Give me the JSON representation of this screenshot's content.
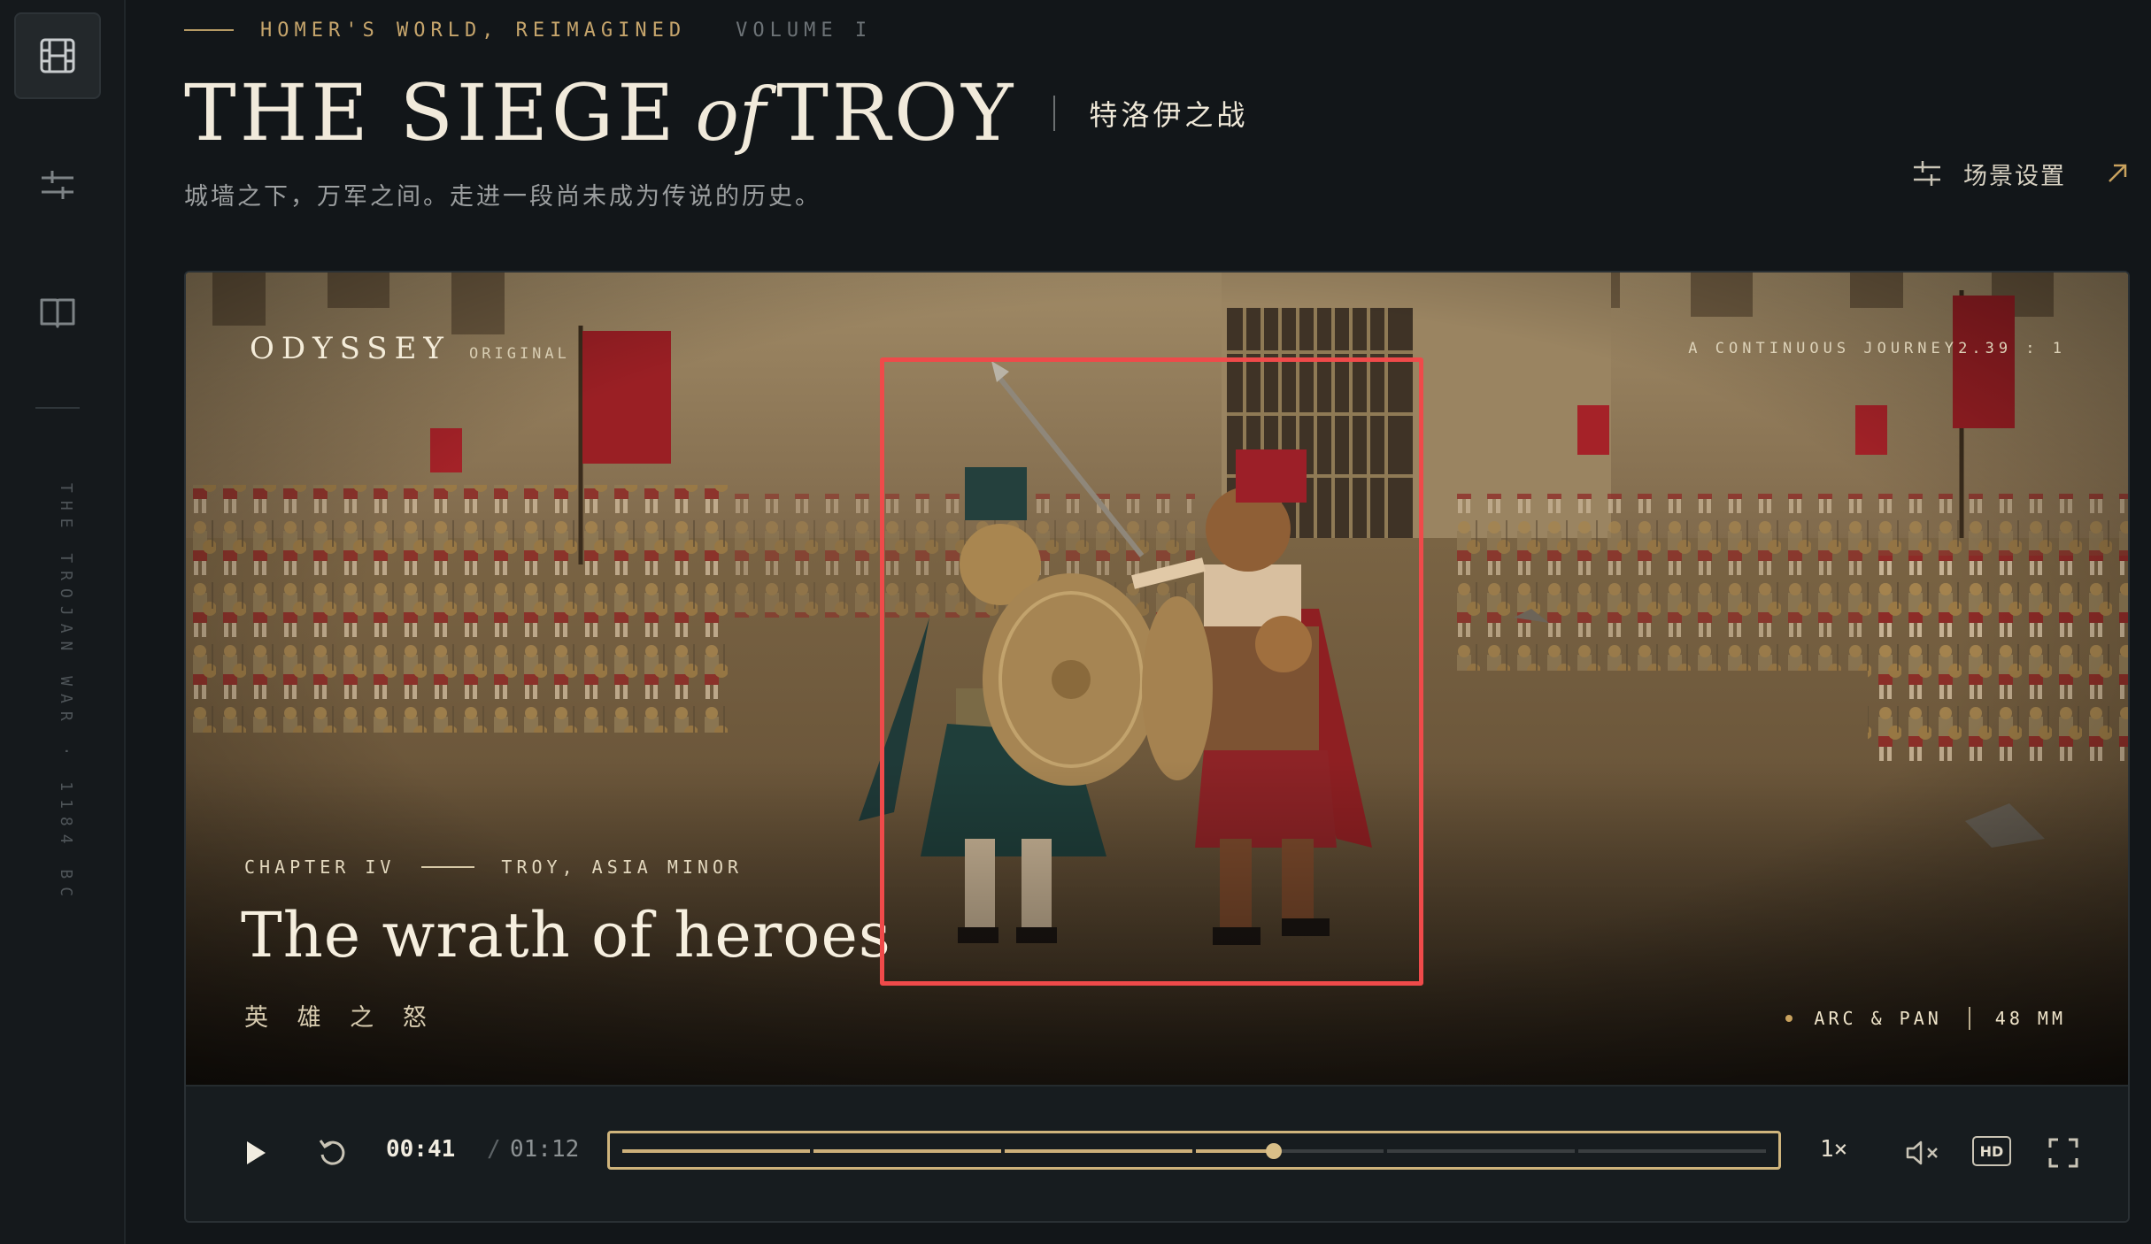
{
  "rail": {
    "items": [
      {
        "name": "film-icon",
        "active": true
      },
      {
        "name": "sliders-icon",
        "active": false
      },
      {
        "name": "book-icon",
        "active": false
      }
    ],
    "vertical_text": "THE TROJAN WAR · 1184 BC"
  },
  "header": {
    "series": "HOMER'S WORLD, REIMAGINED",
    "volume": "VOLUME I",
    "title_pre": "THE SIEGE",
    "title_of": "of",
    "title_post": "TROY",
    "title_cn": "特洛伊之战",
    "subtitle": "城墙之下，万军之间。走进一段尚未成为传说的历史。",
    "settings_label": "场景设置",
    "settings_icon": "sliders-icon",
    "external_icon": "arrow-up-right-icon"
  },
  "scene": {
    "brand": "ODYSSEY",
    "brand_sub": "ORIGINAL",
    "journey": "A CONTINUOUS JOURNEY",
    "aspect_ratio": "2.39 : 1",
    "chapter": "CHAPTER IV",
    "location": "TROY, ASIA MINOR",
    "title": "The wrath of heroes",
    "title_cn": "英 雄 之 怒",
    "camera_move": "ARC & PAN",
    "focal_length": "48 MM",
    "highlight_color": "#ef4a4a"
  },
  "controls": {
    "play_icon": "play-icon",
    "replay_icon": "replay-icon",
    "current_time": "00:41",
    "separator": "/",
    "total_time": "01:12",
    "progress": 0.57,
    "segments": 6,
    "speed": "1×",
    "mute_icon": "volume-muted-icon",
    "quality": "HD",
    "fullscreen_icon": "fullscreen-icon"
  },
  "colors": {
    "background": "#121619",
    "accent_gold": "#cfb47c",
    "text": "#f1eadb",
    "muted": "#9c9fa0"
  }
}
